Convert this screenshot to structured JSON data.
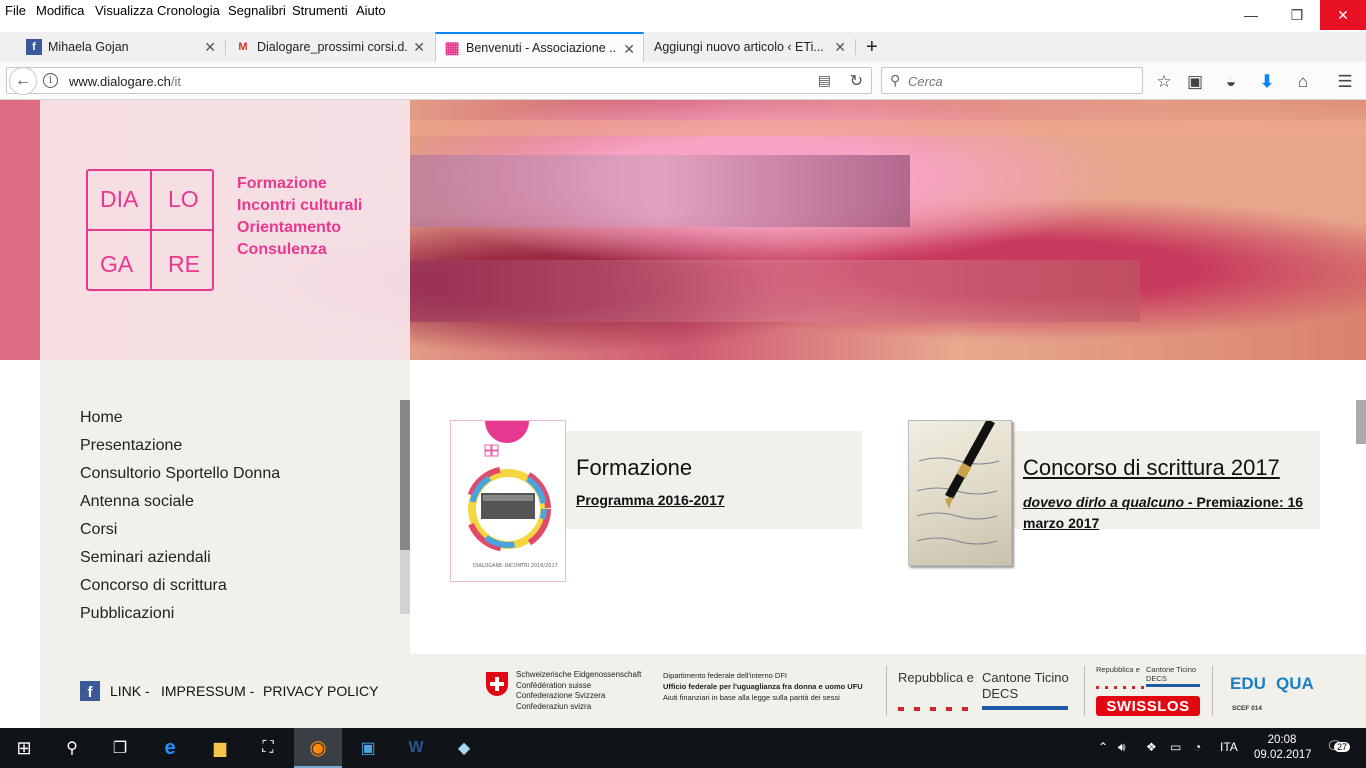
{
  "menubar": {
    "items": [
      "File",
      "Modifica",
      "Visualizza",
      "Cronologia",
      "Segnalibri",
      "Strumenti",
      "Aiuto"
    ]
  },
  "window_controls": {
    "minimize": "—",
    "restore": "❐",
    "close": "✕"
  },
  "tabs": [
    {
      "label": "Mihaela Gojan",
      "favicon": "facebook-icon",
      "fav_text": "f"
    },
    {
      "label": "Dialogare_prossimi corsi.d...",
      "favicon": "gmail-icon",
      "fav_text": "M"
    },
    {
      "label": "Benvenuti - Associazione ...",
      "favicon": "dialogare-icon",
      "fav_text": "▦"
    },
    {
      "label": "Aggiungi nuovo articolo ‹ ETi...",
      "favicon": "wordpress-icon",
      "fav_text": ""
    }
  ],
  "new_tab": "+",
  "navbar": {
    "url_host": "www.dialogare.ch",
    "url_path": "/it",
    "search_placeholder": "Cerca",
    "icons": [
      "star-icon",
      "reading-list-icon",
      "pocket-icon",
      "download-icon",
      "home-icon",
      "menu-icon"
    ]
  },
  "site": {
    "logo": [
      "DIA",
      "LO",
      "GA",
      "RE"
    ],
    "tagline": [
      "Formazione",
      "Incontri culturali",
      "Orientamento",
      "Consulenza"
    ],
    "nav": [
      "Home",
      "Presentazione",
      "Consultorio Sportello Donna",
      "Antenna sociale",
      "Corsi",
      "Seminari aziendali",
      "Concorso di scrittura",
      "Pubblicazioni"
    ],
    "card1": {
      "title": "Formazione",
      "link": "Programma 2016-2017",
      "thumb_caption": "DIALOGARE–INCONTRI 2016/2017"
    },
    "card2": {
      "title": "Concorso di scrittura 2017",
      "link_italic": "dovevo dirlo a qualcuno",
      "link_rest": " - Premiazione: 16 marzo 2017"
    },
    "footer": {
      "links": [
        "LINK -",
        "IMPRESSUM -",
        "PRIVACY POLICY"
      ],
      "confed": [
        "Schweizerische Eidgenossenschaft",
        "Confédération suisse",
        "Confederazione Svizzera",
        "Confederaziun svizra"
      ],
      "dfi": [
        "Dipartimento federale dell'interno DFI",
        "Ufficio federale per l'uguaglianza fra donna e uomo UFU",
        "Aiuti finanziari in base alla legge sulla parità dei sessi"
      ],
      "ticino": {
        "left": "Repubblica e",
        "right": "Cantone Ticino",
        "sub": "DECS"
      },
      "swisslos": {
        "top_left": "Repubblica e",
        "top_right": "Cantone Ticino",
        "sub": "DECS",
        "name": "SWISSLOS"
      },
      "eduqua": {
        "name_a": "EDU",
        "name_b": "QUA",
        "sub": "SCEF 014"
      }
    }
  },
  "taskbar": {
    "lang": "ITA",
    "time": "20:08",
    "date": "09.02.2017",
    "notifications": "27"
  },
  "colors": {
    "brand_pink": "#e8388f",
    "panel_beige": "#f2f0eb",
    "taskbar": "#101419",
    "close_red": "#e81123"
  }
}
